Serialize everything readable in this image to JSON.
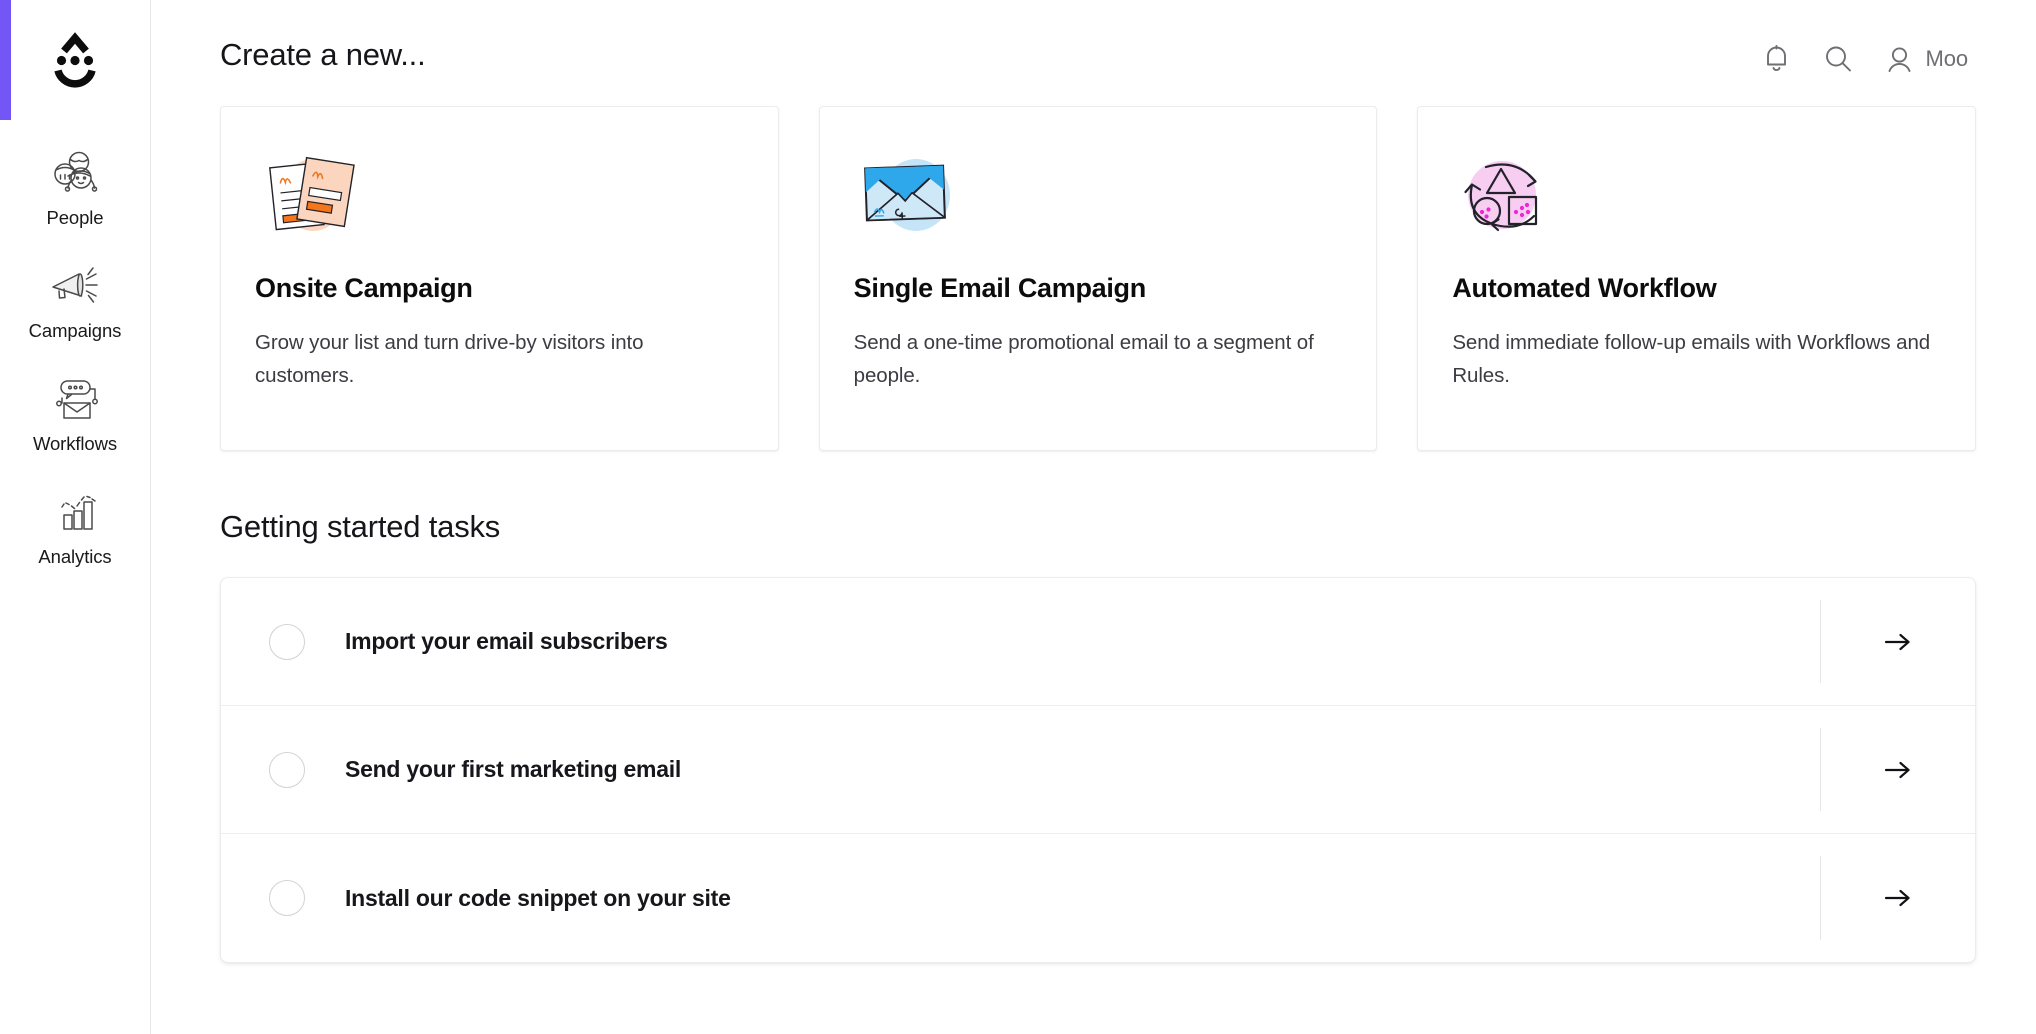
{
  "brand": {
    "logo_icon": "smiley-drop-logo",
    "accent_color": "#7455f5"
  },
  "sidebar": {
    "items": [
      {
        "label": "People",
        "icon": "people-icon"
      },
      {
        "label": "Campaigns",
        "icon": "megaphone-icon"
      },
      {
        "label": "Workflows",
        "icon": "chat-envelope-icon"
      },
      {
        "label": "Analytics",
        "icon": "bar-chart-icon"
      }
    ]
  },
  "header": {
    "title": "Create a new...",
    "notifications_icon": "bell-icon",
    "search_icon": "search-icon",
    "account_icon": "person-icon",
    "user_name": "Moo"
  },
  "create_cards": [
    {
      "title": "Onsite Campaign",
      "description": "Grow your list and turn drive-by visitors into customers.",
      "icon": "onsite-flyers-icon",
      "blob_color": "#fbd5bd"
    },
    {
      "title": "Single Email Campaign",
      "description": "Send a one-time promotional email to a segment of people.",
      "icon": "envelope-icon",
      "blob_color": "#c5e4f7"
    },
    {
      "title": "Automated Workflow",
      "description": "Send immediate follow-up emails with Workflows and Rules.",
      "icon": "workflow-loop-icon",
      "blob_color": "#f7cdf2"
    }
  ],
  "getting_started": {
    "title": "Getting started tasks",
    "tasks": [
      {
        "label": "Import your email subscribers",
        "completed": false,
        "action_icon": "arrow-right-icon"
      },
      {
        "label": "Send your first marketing email",
        "completed": false,
        "action_icon": "arrow-right-icon"
      },
      {
        "label": "Install our code snippet on your site",
        "completed": false,
        "action_icon": "arrow-right-icon"
      }
    ]
  }
}
